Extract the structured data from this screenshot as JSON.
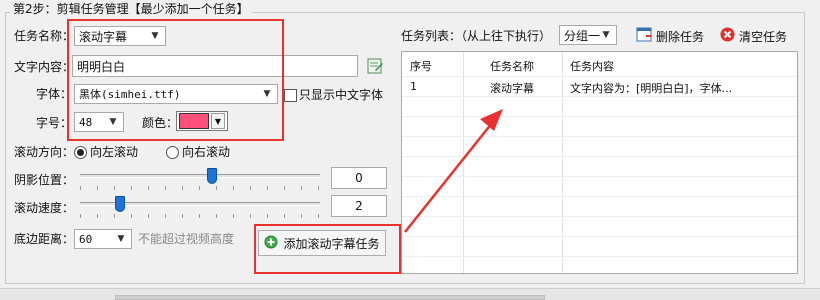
{
  "step_title": "第2步：剪辑任务管理【最少添加一个任务】",
  "task_name": {
    "label": "任务名称：",
    "value": "滚动字幕"
  },
  "text_content": {
    "label": "文字内容：",
    "value": "明明白白"
  },
  "font": {
    "label": "字体：",
    "value": "黑体(simhei.ttf)",
    "chinese_only_label": "只显示中文字体"
  },
  "font_size": {
    "label": "字号：",
    "value": "48"
  },
  "color": {
    "label": "颜色：",
    "swatch": "#ff4f7a"
  },
  "scroll_direction": {
    "label": "滚动方向：",
    "left": "向左滚动",
    "right": "向右滚动",
    "selected": "left"
  },
  "shadow": {
    "label": "阴影位置：",
    "value": "0",
    "level": 0.55
  },
  "speed": {
    "label": "滚动速度：",
    "value": "2",
    "level": 0.15
  },
  "bottom": {
    "label": "底边距离：",
    "value": "60",
    "hint": "不能超过视频高度"
  },
  "add_button": {
    "label": "添加滚动字幕任务"
  },
  "task_list": {
    "label": "任务列表：（从上往下执行）",
    "group_value": "分组一",
    "delete_label": "删除任务",
    "clear_label": "清空任务",
    "columns": [
      "序号",
      "任务名称",
      "任务内容"
    ],
    "rows": [
      {
        "index": "1",
        "name": "滚动字幕",
        "content": "文字内容为：[明明白白]，字体..."
      }
    ]
  },
  "colors": {
    "annotation_red": "#e8322f",
    "slider_blue": "#1e73d8"
  }
}
